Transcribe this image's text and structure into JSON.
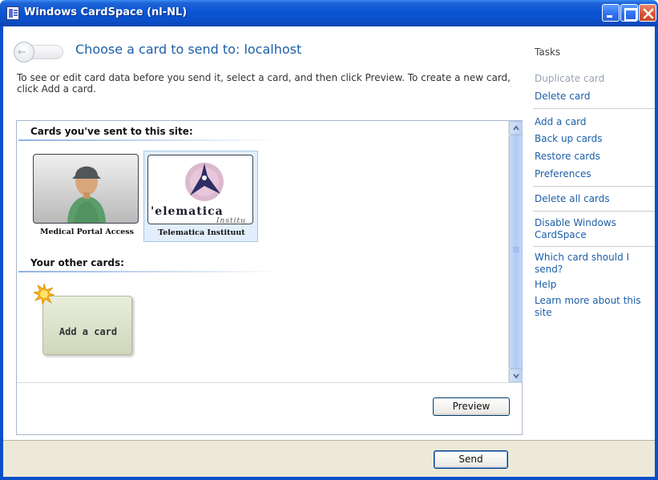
{
  "window": {
    "title": "Windows CardSpace  (nl-NL)"
  },
  "header": {
    "title": "Choose a card to send to: localhost",
    "intro": "To see or edit card data before you send it, select a card, and then click Preview. To create a new card, click Add a card."
  },
  "sections": {
    "sent": "Cards you've sent to this site:",
    "other": "Your other cards:"
  },
  "cards": [
    {
      "label": "Medical Portal Access",
      "selected": false,
      "icon": "person-card-image"
    },
    {
      "label": "Telematica Instituut",
      "selected": true,
      "icon": "telematica-logo",
      "logo_text": "'elematica",
      "logo_subtext": "Institu"
    }
  ],
  "add_card": {
    "label": "Add a card",
    "icon": "star-icon"
  },
  "buttons": {
    "preview": "Preview",
    "send": "Send"
  },
  "tasks": {
    "title": "Tasks",
    "items": [
      {
        "label": "Duplicate card",
        "enabled": false
      },
      {
        "label": "Delete card",
        "enabled": true
      },
      {
        "label": "Add a card",
        "enabled": true
      },
      {
        "label": "Back up cards",
        "enabled": true
      },
      {
        "label": "Restore cards",
        "enabled": true
      },
      {
        "label": "Preferences",
        "enabled": true
      },
      {
        "label": "Delete all cards",
        "enabled": true
      },
      {
        "label": "Disable Windows CardSpace",
        "enabled": true
      },
      {
        "label": "Which card should I send?",
        "enabled": true
      },
      {
        "label": "Help",
        "enabled": true
      },
      {
        "label": "Learn more about this site",
        "enabled": true
      }
    ]
  },
  "colors": {
    "titlebar": "#0b4fc8",
    "link": "#1c5fa8",
    "disabled_link": "#9aa4b3",
    "selection": "#e2eefb",
    "dialog_bg": "#ece9d8"
  }
}
